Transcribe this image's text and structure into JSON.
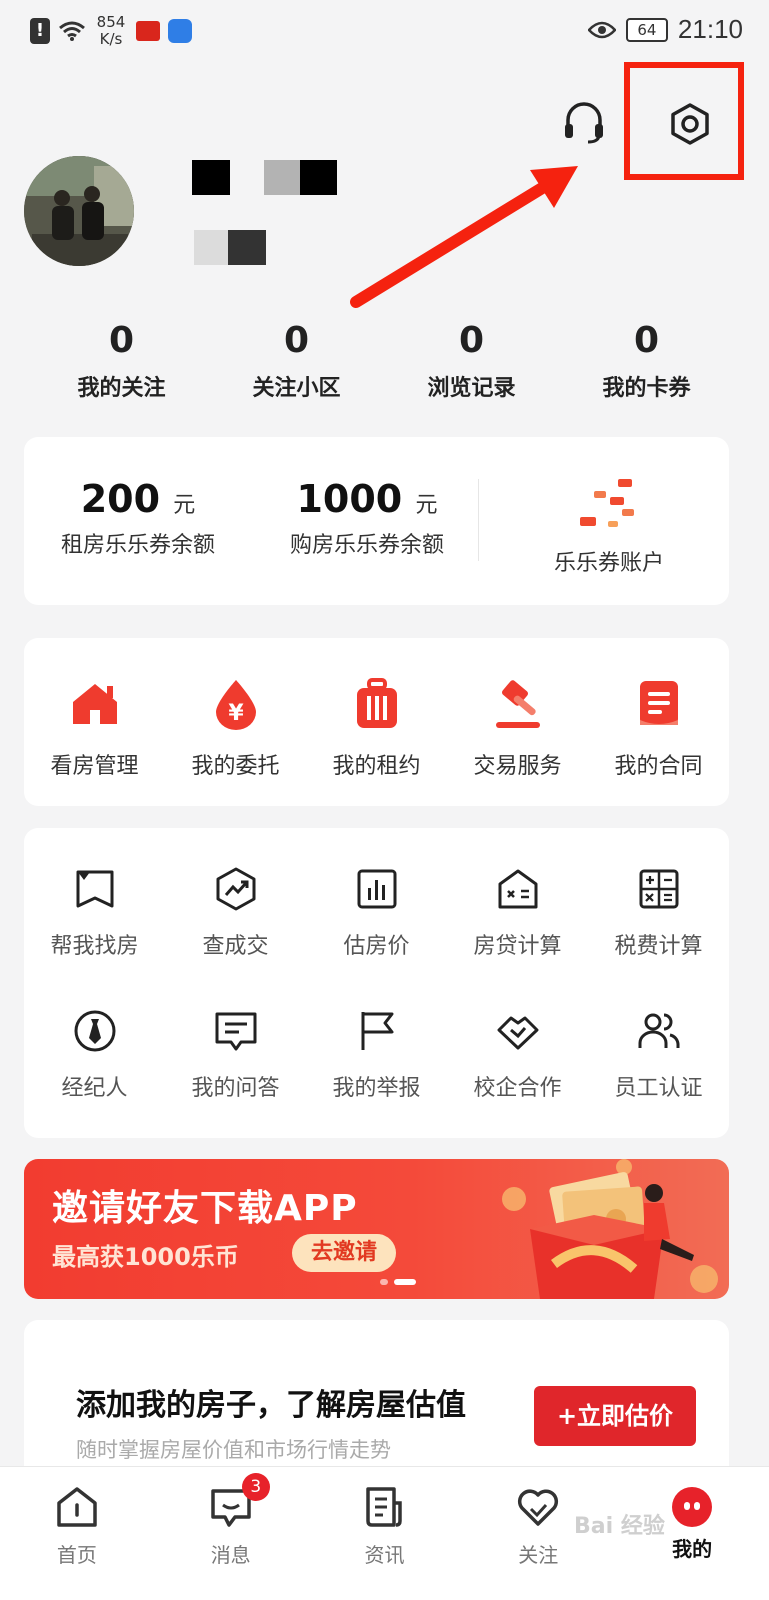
{
  "status_bar": {
    "net_speed_value": "854",
    "net_speed_unit": "K/s",
    "battery": "64",
    "time": "21:10"
  },
  "header": {
    "icons": [
      "headset-icon",
      "settings-icon"
    ]
  },
  "stats": [
    {
      "value": "0",
      "label": "我的关注"
    },
    {
      "value": "0",
      "label": "关注小区"
    },
    {
      "value": "0",
      "label": "浏览记录"
    },
    {
      "value": "0",
      "label": "我的卡券"
    }
  ],
  "coupons": {
    "rent": {
      "amount": "200",
      "unit": "元",
      "label": "租房乐乐券余额"
    },
    "buy": {
      "amount": "1000",
      "unit": "元",
      "label": "购房乐乐券余额"
    },
    "account_label": "乐乐券账户"
  },
  "services": [
    {
      "label": "看房管理",
      "icon": "house-icon"
    },
    {
      "label": "我的委托",
      "icon": "yuan-drop-icon"
    },
    {
      "label": "我的租约",
      "icon": "luggage-icon"
    },
    {
      "label": "交易服务",
      "icon": "gavel-icon"
    },
    {
      "label": "我的合同",
      "icon": "contract-icon"
    }
  ],
  "tools": [
    {
      "label": "帮我找房",
      "icon": "map-flag-icon"
    },
    {
      "label": "查成交",
      "icon": "trend-hexagon-icon"
    },
    {
      "label": "估房价",
      "icon": "bar-chart-icon"
    },
    {
      "label": "房贷计算",
      "icon": "house-calc-icon"
    },
    {
      "label": "税费计算",
      "icon": "calculator-icon"
    },
    {
      "label": "经纪人",
      "icon": "agent-tie-icon"
    },
    {
      "label": "我的问答",
      "icon": "chat-icon"
    },
    {
      "label": "我的举报",
      "icon": "flag-icon"
    },
    {
      "label": "校企合作",
      "icon": "handshake-icon"
    },
    {
      "label": "员工认证",
      "icon": "people-icon"
    }
  ],
  "banner": {
    "title": "邀请好友下载APP",
    "subtitle": "最高获1000乐币",
    "button": "去邀请"
  },
  "valuation": {
    "title": "添加我的房子，了解房屋估值",
    "subtitle": "随时掌握房屋价值和市场行情走势",
    "button": "+立即估价"
  },
  "bottom_nav": [
    {
      "label": "首页",
      "icon": "home-icon"
    },
    {
      "label": "消息",
      "icon": "message-icon",
      "badge": "3"
    },
    {
      "label": "资讯",
      "icon": "news-icon"
    },
    {
      "label": "关注",
      "icon": "heart-icon"
    },
    {
      "label": "我的",
      "icon": "profile-icon",
      "active": true
    }
  ],
  "watermark": "Bai 经验",
  "colors": {
    "accent": "#e0262b",
    "highlight": "#f5220f"
  }
}
